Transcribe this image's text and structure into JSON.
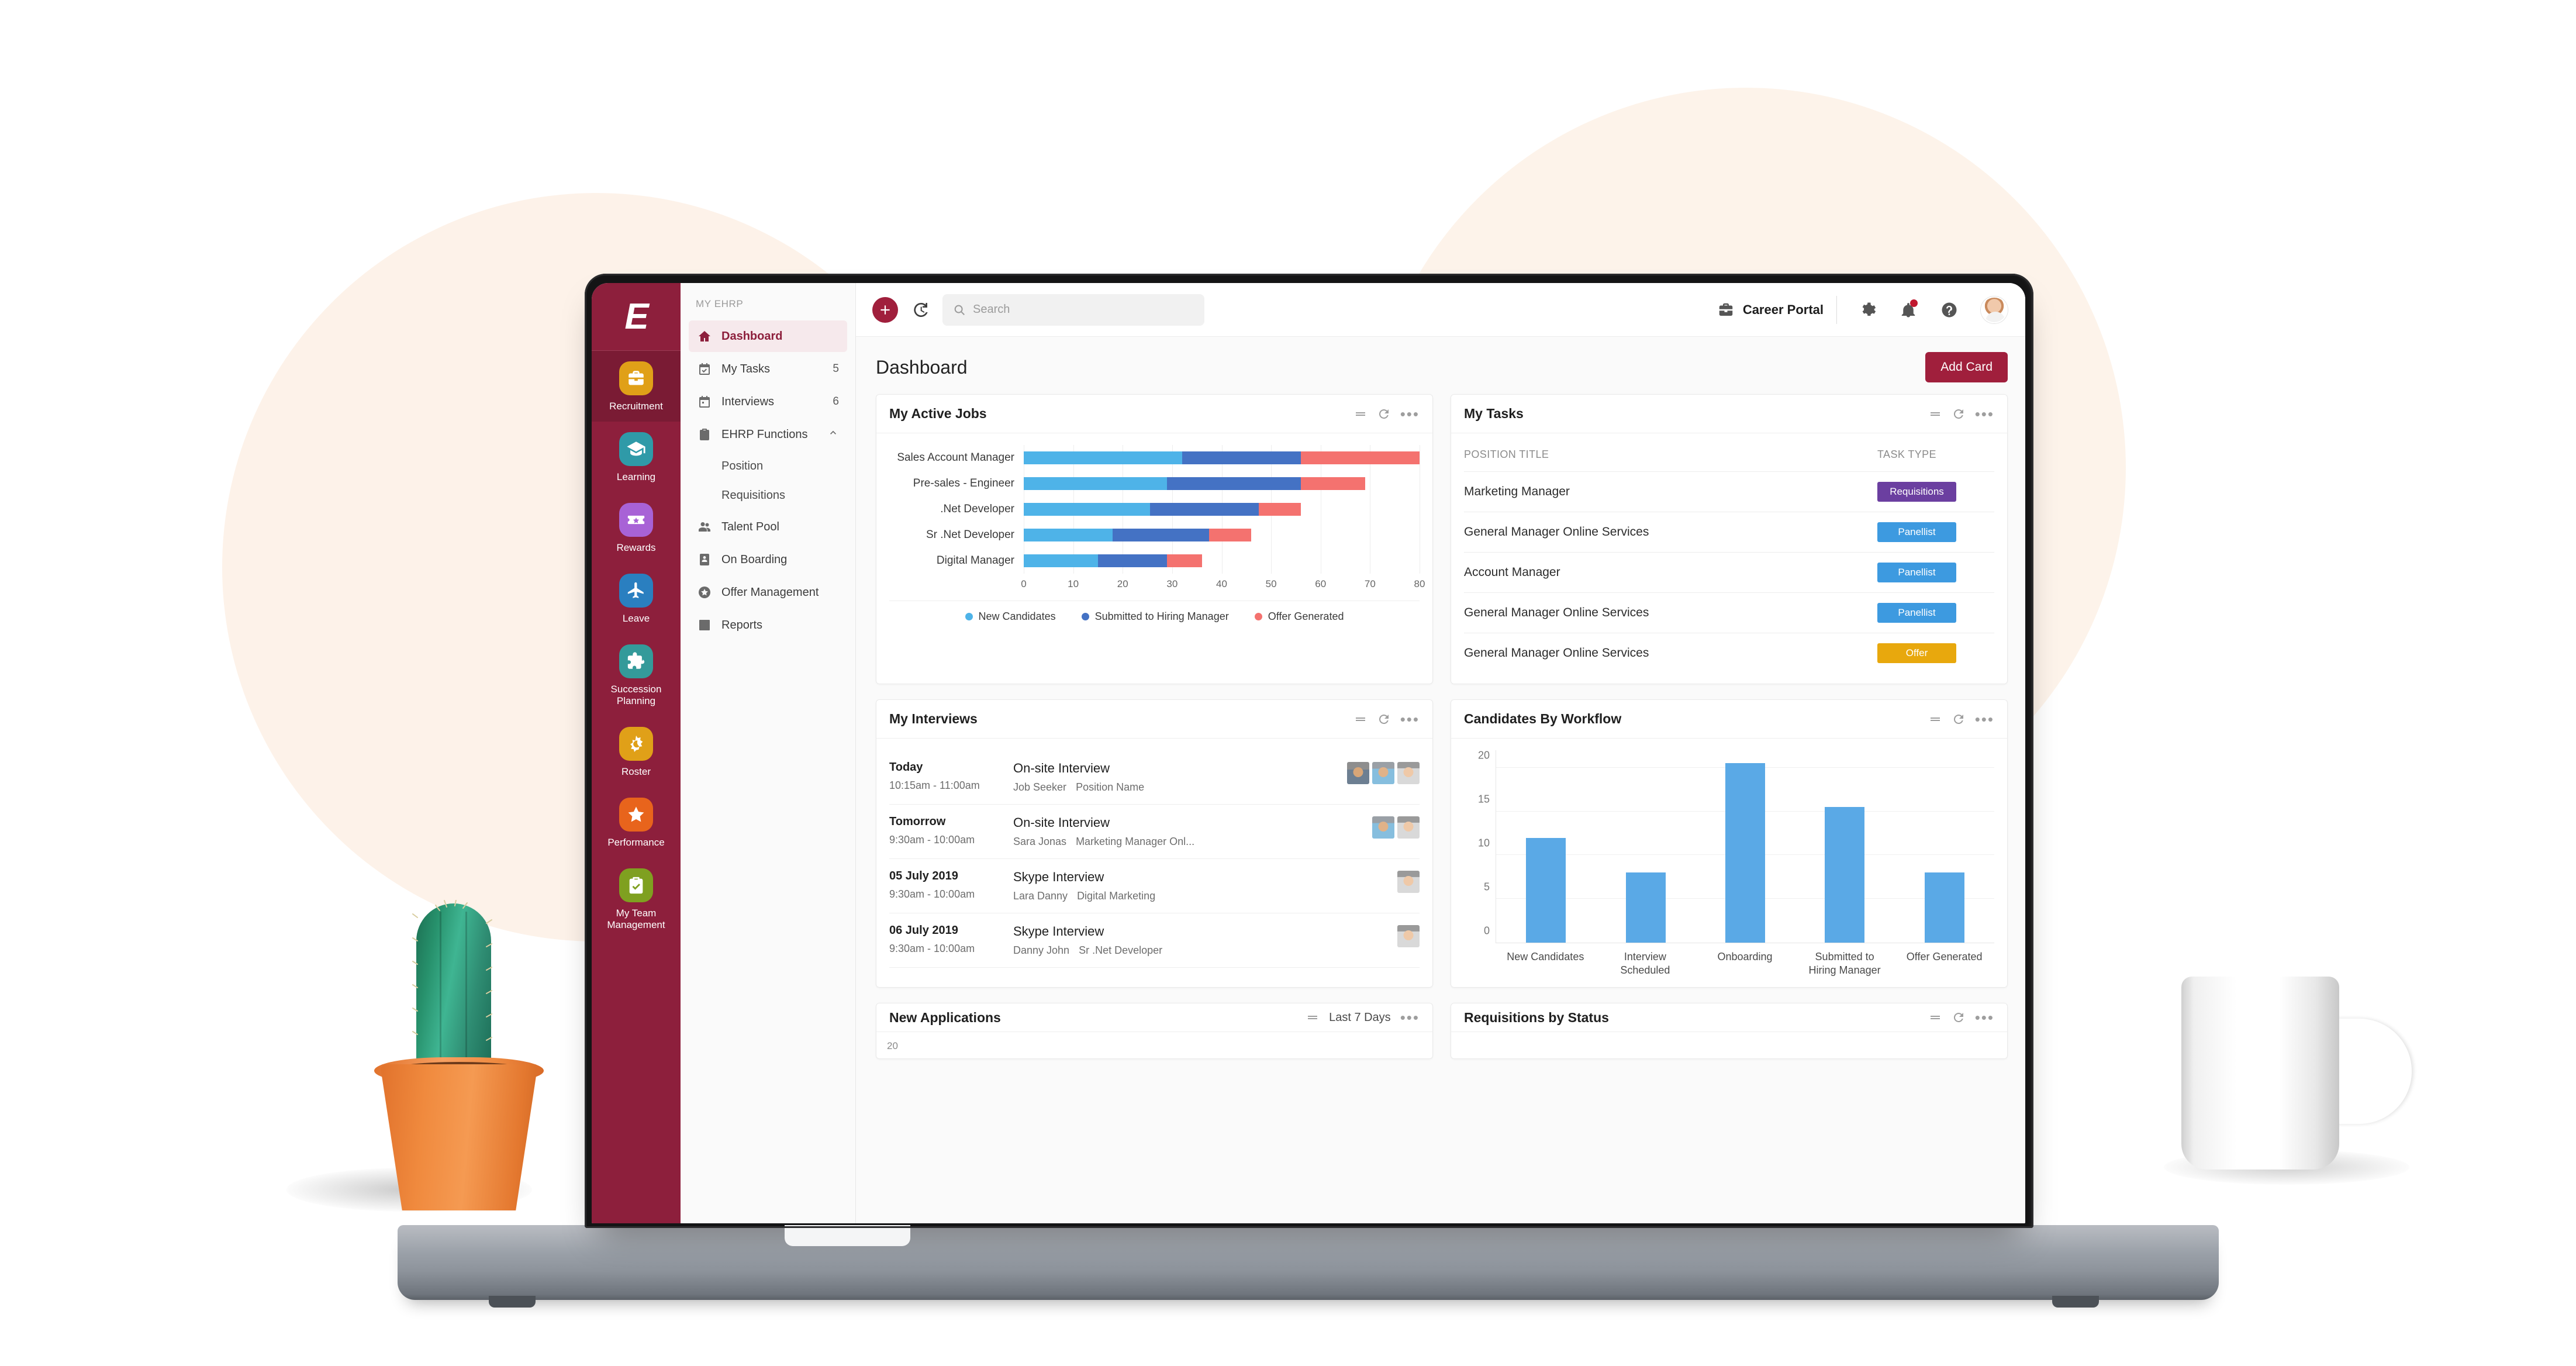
{
  "rail": {
    "logo": "E",
    "items": [
      {
        "label": "Recruitment",
        "icon": "briefcase-icon",
        "color": "#e0a018",
        "active": true
      },
      {
        "label": "Learning",
        "icon": "graduation-cap-icon",
        "color": "#2f9aa8",
        "active": false
      },
      {
        "label": "Rewards",
        "icon": "ticket-star-icon",
        "color": "#a862d6",
        "active": false
      },
      {
        "label": "Leave",
        "icon": "airplane-icon",
        "color": "#2a7fc0",
        "active": false
      },
      {
        "label": "Succession Planning",
        "icon": "puzzle-piece-icon",
        "color": "#349a9a",
        "active": false
      },
      {
        "label": "Roster",
        "icon": "moon-sun-icon",
        "color": "#e0a018",
        "active": false
      },
      {
        "label": "Performance",
        "icon": "star-icon",
        "color": "#e8641c",
        "active": false
      },
      {
        "label": "My Team Management",
        "icon": "clipboard-check-icon",
        "color": "#7fa020",
        "active": false
      }
    ]
  },
  "subnav": {
    "title": "MY EHRP",
    "items": [
      {
        "label": "Dashboard",
        "icon": "home-icon",
        "badge": "",
        "active": true,
        "chevron": ""
      },
      {
        "label": "My Tasks",
        "icon": "calendar-check-icon",
        "badge": "5",
        "active": false,
        "chevron": ""
      },
      {
        "label": "Interviews",
        "icon": "calendar-icon",
        "badge": "6",
        "active": false,
        "chevron": ""
      },
      {
        "label": "EHRP Functions",
        "icon": "clipboard-icon",
        "badge": "",
        "active": false,
        "chevron": "chevron-up-icon"
      }
    ],
    "sub_items": [
      "Position",
      "Requisitions"
    ],
    "items_after": [
      {
        "label": "Talent Pool",
        "icon": "people-icon"
      },
      {
        "label": "On Boarding",
        "icon": "id-card-icon"
      },
      {
        "label": "Offer Management",
        "icon": "star-circle-icon"
      },
      {
        "label": "Reports",
        "icon": "bar-chart-icon"
      }
    ]
  },
  "topbar": {
    "add_icon": "plus-circle-icon",
    "history_icon": "history-icon",
    "search_placeholder": "Search",
    "search_value": "",
    "search_icon": "search-icon",
    "portal_label": "Career Portal",
    "portal_icon": "briefcase-icon",
    "settings_icon": "gear-icon",
    "bell_icon": "bell-icon",
    "help_icon": "question-circle-icon",
    "avatar": "avatar"
  },
  "page": {
    "title": "Dashboard",
    "add_card_label": "Add Card"
  },
  "cards": {
    "active_jobs": {
      "title": "My Active Jobs"
    },
    "my_tasks": {
      "title": "My Tasks",
      "col_position": "POSITION TITLE",
      "col_task_type": "TASK TYPE",
      "rows": [
        {
          "position": "Marketing Manager",
          "type": "Requisitions",
          "color": "#6b3fa0"
        },
        {
          "position": "General Manager Online Services",
          "type": "Panellist",
          "color": "#3d9ae0"
        },
        {
          "position": "Account Manager",
          "type": "Panellist",
          "color": "#3d9ae0"
        },
        {
          "position": "General Manager Online Services",
          "type": "Panellist",
          "color": "#3d9ae0"
        },
        {
          "position": "General Manager Online Services",
          "type": "Offer",
          "color": "#e8a80d"
        }
      ]
    },
    "my_interviews": {
      "title": "My Interviews",
      "rows": [
        {
          "date": "Today",
          "time": "10:15am - 11:00am",
          "type": "On-site Interview",
          "person": "Job Seeker",
          "position": "Position Name",
          "faces": [
            "m1",
            "m2",
            "f1"
          ]
        },
        {
          "date": "Tomorrow",
          "time": "9:30am - 10:00am",
          "type": "On-site Interview",
          "person": "Sara Jonas",
          "position": "Marketing Manager Onl...",
          "faces": [
            "m2",
            "f1"
          ]
        },
        {
          "date": "05 July 2019",
          "time": "9:30am - 10:00am",
          "type": "Skype Interview",
          "person": "Lara Danny",
          "position": "Digital Marketing",
          "faces": [
            "f1"
          ]
        },
        {
          "date": "06 July 2019",
          "time": "9:30am - 10:00am",
          "type": "Skype Interview",
          "person": "Danny John",
          "position": "Sr .Net Developer",
          "faces": [
            "f1"
          ]
        }
      ]
    },
    "candidates_workflow": {
      "title": "Candidates By Workflow"
    },
    "new_applications": {
      "title": "New Applications",
      "range": "Last 7 Days",
      "axis_top": "20"
    },
    "requisitions_status": {
      "title": "Requisitions by Status"
    }
  },
  "chart_data": [
    {
      "type": "bar",
      "orientation": "horizontal",
      "stacked": true,
      "title": "My Active Jobs",
      "categories": [
        "Sales Account Manager",
        "Pre-sales - Engineer",
        ".Net Developer",
        "Sr .Net Developer",
        "Digital Manager"
      ],
      "series": [
        {
          "name": "New Candidates",
          "color": "#4eb3e8",
          "values": [
            32,
            29,
            25.5,
            18,
            15
          ]
        },
        {
          "name": "Submitted to Hiring Manager",
          "color": "#4472c4",
          "values": [
            24,
            27,
            22,
            19.5,
            14
          ]
        },
        {
          "name": "Offer Generated",
          "color": "#f4726f",
          "values": [
            24,
            13,
            8.5,
            8.5,
            7
          ]
        }
      ],
      "xlabel": "",
      "ylabel": "",
      "xlim": [
        0,
        80
      ],
      "xticks": [
        0,
        10,
        20,
        30,
        40,
        50,
        60,
        70,
        80
      ],
      "grid": true,
      "legend_position": "bottom"
    },
    {
      "type": "bar",
      "orientation": "vertical",
      "title": "Candidates By Workflow",
      "categories": [
        "New Candidates",
        "Interview Scheduled",
        "Onboarding",
        "Submitted to Hiring Manager",
        "Offer Generated"
      ],
      "values": [
        12,
        8,
        20.5,
        15.5,
        8
      ],
      "color": "#5aa9e6",
      "ylim": [
        0,
        22
      ],
      "yticks": [
        0,
        5,
        10,
        15,
        20
      ],
      "xlabel": "",
      "ylabel": "",
      "grid": true,
      "legend_position": "none"
    }
  ]
}
